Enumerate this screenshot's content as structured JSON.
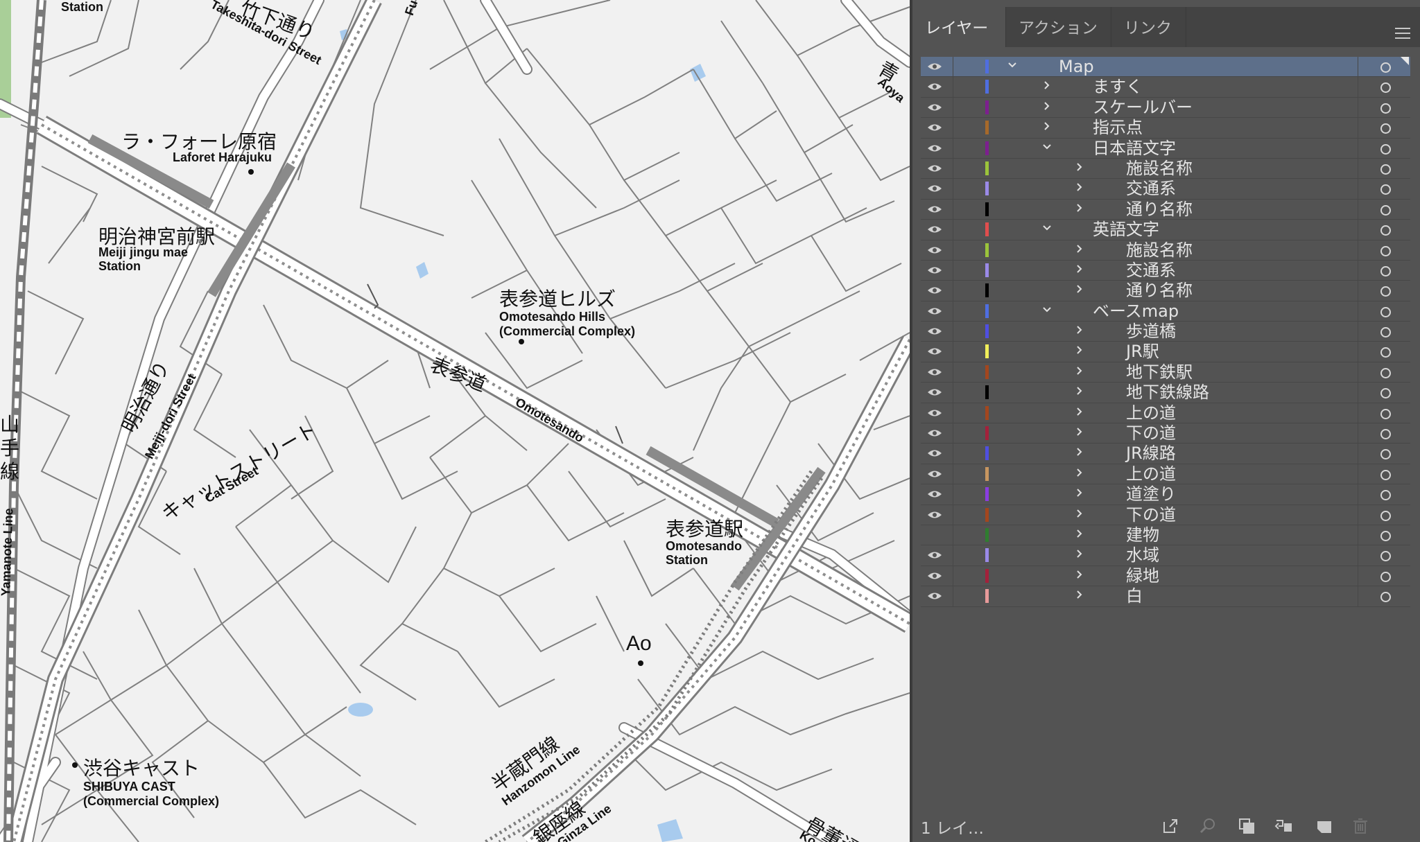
{
  "map": {
    "labels": {
      "station_top": "Station",
      "takeshita_jp": "竹下通り",
      "takeshita_en": "Takeshita-dori Street",
      "laforet_jp": "ラ・フォーレ原宿",
      "laforet_en": "Laforet Harajuku",
      "meiji_jp": "明治神宮前駅",
      "meiji_en1": "Meiji jingu mae",
      "meiji_en2": "Station",
      "hills_jp": "表参道ヒルズ",
      "hills_en1": "Omotesando Hills",
      "hills_en2": "(Commercial Complex)",
      "omotesando_jp": "表参道",
      "omotesando_en": "Omotesando",
      "meijidori_jp": "明治通り",
      "meijidori_en": "Meiji-dori Street",
      "cat_jp": "キャットストリート",
      "cat_en": "Cat Street",
      "yamanote_jp": "山手線",
      "yamanote_en": "Yamanote Line",
      "station_jp": "表参道駅",
      "station_en1": "Omotesando",
      "station_en2": "Station",
      "ao": "Ao",
      "hanzomon_jp": "半蔵門線",
      "hanzomon_en": "Hanzomon Line",
      "ginza_jp": "銀座線",
      "ginza_en": "Ginza Line",
      "shibuya_jp": "渋谷キャスト",
      "shibuya_en1": "SHIBUYA CAST",
      "shibuya_en2": "(Commercial Complex)",
      "aoyama_jp": "青",
      "aoyama_en": "Aoya",
      "kotto_jp": "骨董通",
      "kotto_en": "Ko",
      "fu": "Fu"
    }
  },
  "panel": {
    "tabs": [
      "レイヤー",
      "アクション",
      "リンク"
    ],
    "layers": [
      {
        "name": "Map",
        "color": "#4f6ee0",
        "depth": 0,
        "open": true,
        "visible": true,
        "selected": true
      },
      {
        "name": "ますく",
        "color": "#4f6ee0",
        "depth": 1,
        "open": false,
        "visible": true
      },
      {
        "name": "スケールバー",
        "color": "#7d1f8f",
        "depth": 1,
        "open": false,
        "visible": true
      },
      {
        "name": "指示点",
        "color": "#a6692a",
        "depth": 1,
        "open": false,
        "visible": true
      },
      {
        "name": "日本語文字",
        "color": "#7d1f8f",
        "depth": 1,
        "open": true,
        "visible": true
      },
      {
        "name": "施設名称",
        "color": "#9bc43b",
        "depth": 2,
        "open": false,
        "visible": true
      },
      {
        "name": "交通系",
        "color": "#9a8ae8",
        "depth": 2,
        "open": false,
        "visible": true
      },
      {
        "name": "通り名称",
        "color": "#000000",
        "depth": 2,
        "open": false,
        "visible": true
      },
      {
        "name": "英語文字",
        "color": "#e04d4d",
        "depth": 1,
        "open": true,
        "visible": true
      },
      {
        "name": "施設名称",
        "color": "#9bc43b",
        "depth": 2,
        "open": false,
        "visible": true
      },
      {
        "name": "交通系",
        "color": "#9a8ae8",
        "depth": 2,
        "open": false,
        "visible": true
      },
      {
        "name": "通り名称",
        "color": "#000000",
        "depth": 2,
        "open": false,
        "visible": true
      },
      {
        "name": "ベースmap",
        "color": "#4f6ee0",
        "depth": 1,
        "open": true,
        "visible": true
      },
      {
        "name": "歩道橋",
        "color": "#4f4fe0",
        "depth": 2,
        "open": false,
        "visible": true
      },
      {
        "name": "JR駅",
        "color": "#f0ee5a",
        "depth": 2,
        "open": false,
        "visible": true
      },
      {
        "name": "地下鉄駅",
        "color": "#a3461e",
        "depth": 2,
        "open": false,
        "visible": true
      },
      {
        "name": "地下鉄線路",
        "color": "#000000",
        "depth": 2,
        "open": false,
        "visible": true
      },
      {
        "name": "上の道",
        "color": "#a3461e",
        "depth": 2,
        "open": false,
        "visible": true
      },
      {
        "name": "下の道",
        "color": "#a3213b",
        "depth": 2,
        "open": false,
        "visible": true
      },
      {
        "name": "JR線路",
        "color": "#4f4fe0",
        "depth": 2,
        "open": false,
        "visible": true
      },
      {
        "name": "上の道",
        "color": "#c79660",
        "depth": 2,
        "open": false,
        "visible": true
      },
      {
        "name": "道塗り",
        "color": "#8a3de0",
        "depth": 2,
        "open": false,
        "visible": true
      },
      {
        "name": "下の道",
        "color": "#a3461e",
        "depth": 2,
        "open": false,
        "visible": true
      },
      {
        "name": "建物",
        "color": "#2f7d2f",
        "depth": 2,
        "open": false,
        "visible": false
      },
      {
        "name": "水域",
        "color": "#9a8ae8",
        "depth": 2,
        "open": false,
        "visible": true
      },
      {
        "name": "緑地",
        "color": "#a3213b",
        "depth": 2,
        "open": false,
        "visible": true
      },
      {
        "name": "白",
        "color": "#e89a9a",
        "depth": 2,
        "open": false,
        "visible": true
      }
    ],
    "footer": {
      "count": "1 レイ…",
      "icons": [
        "export-icon",
        "search-icon",
        "clip-mask-icon",
        "move-to-layer-icon",
        "new-layer-icon",
        "delete-icon"
      ]
    }
  }
}
